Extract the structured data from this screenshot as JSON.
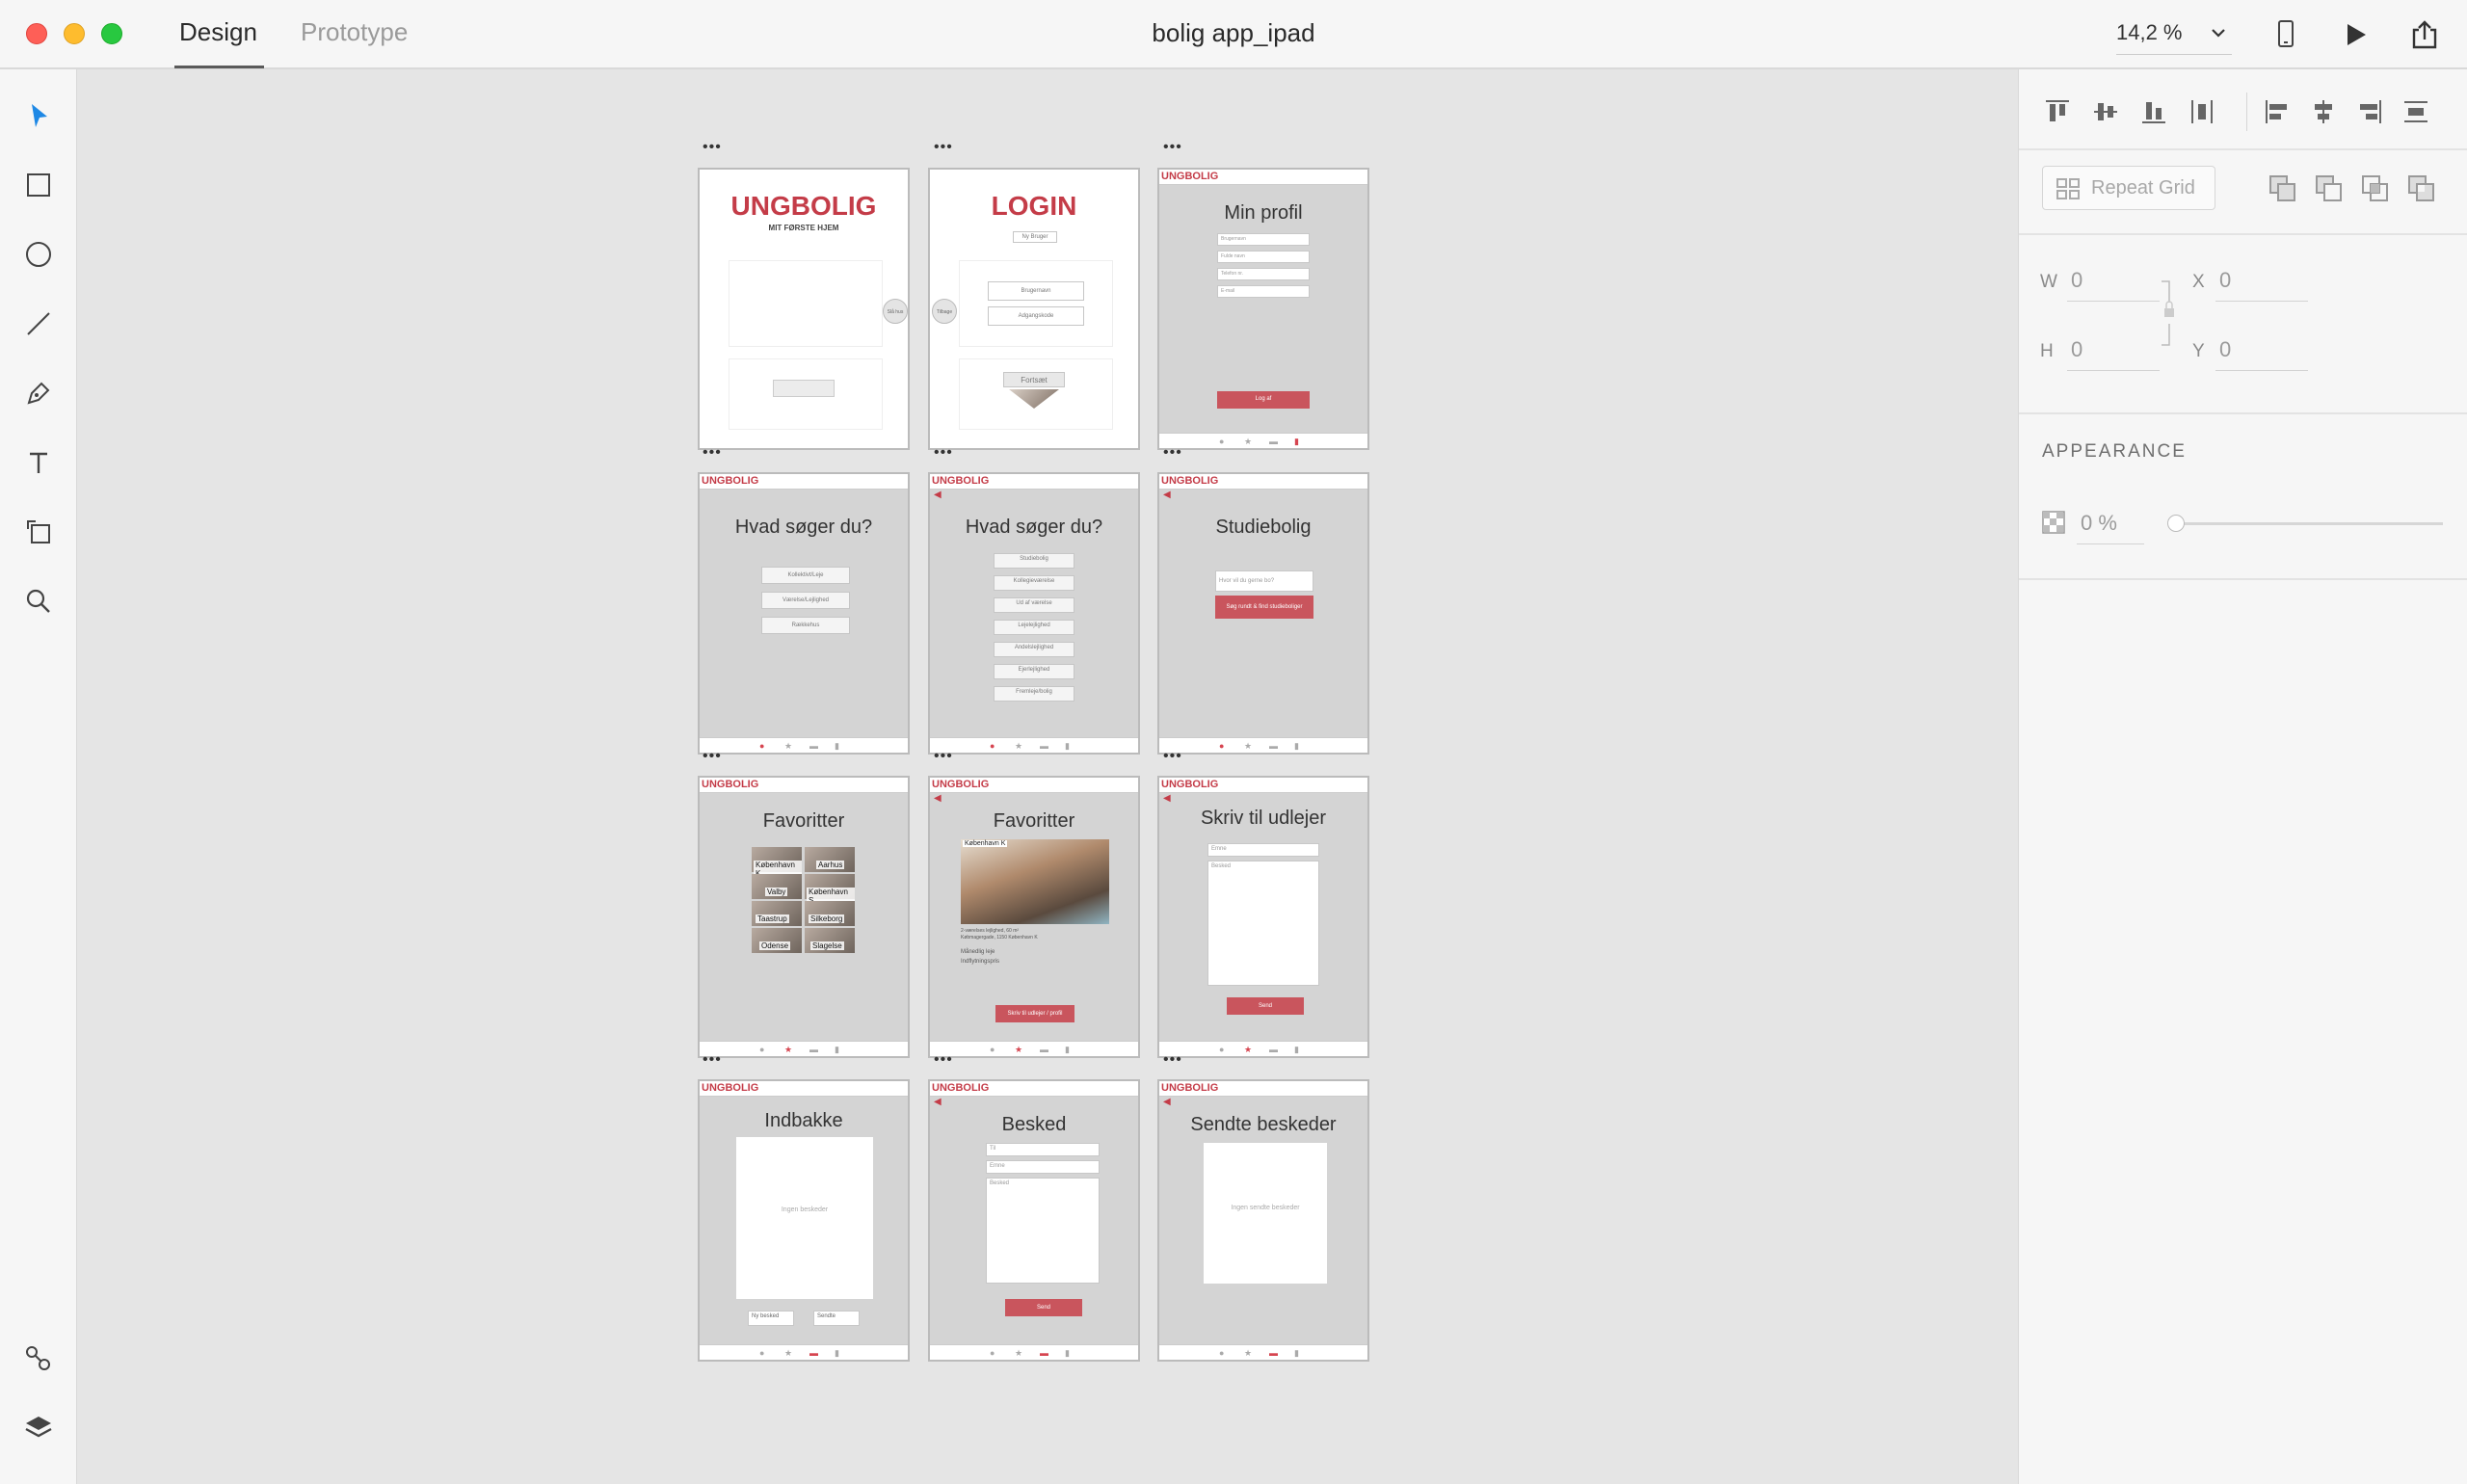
{
  "app": {
    "tabs": [
      "Design",
      "Prototype"
    ],
    "active_tab": "Design",
    "document_title": "bolig app_ipad",
    "zoom": "14,2 %"
  },
  "inspector": {
    "repeat_grid_label": "Repeat Grid",
    "w_label": "W",
    "w_value": "0",
    "x_label": "X",
    "x_value": "0",
    "h_label": "H",
    "h_value": "0",
    "y_label": "Y",
    "y_value": "0",
    "appearance_label": "APPEARANCE",
    "opacity_value": "0 %"
  },
  "brand": {
    "logo": "UNGBOLIG",
    "accent": "#c43c48"
  },
  "artboards": {
    "a1": {
      "logo": "UNGBOLIG",
      "tagline": "MIT FØRSTE HJEM",
      "side_btn": "Slå hus"
    },
    "a2": {
      "title": "LOGIN",
      "new_user": "Ny Bruger",
      "side_btn": "Tilbage",
      "username": "Brugernavn",
      "password": "Adgangskode",
      "continue": "Fortsæt"
    },
    "a3": {
      "title": "Min profil",
      "fields": [
        "Brugernavn",
        "Fulde navn",
        "Telefon nr.",
        "E-mail"
      ],
      "logout": "Log af"
    },
    "a4": {
      "title": "Hvad søger du?",
      "options": [
        "Kollektivt/Leje",
        "Værelse/Lejlighed",
        "Rækkehus"
      ]
    },
    "a5": {
      "title": "Hvad søger du?",
      "options": [
        "Studiebolig",
        "Kollegieværelse",
        "Ud af værelse",
        "Lejelejlighed",
        "Andelslejlighed",
        "Ejerlejlighed",
        "Fremleje/bolig"
      ]
    },
    "a6": {
      "title": "Studiebolig",
      "search_placeholder": "Hvor vil du gerne bo?",
      "button": "Søg rundt & find studieboliger"
    },
    "a7": {
      "title": "Favoritter",
      "cells": [
        "København K",
        "Aarhus",
        "Valby",
        "København S",
        "Taastrup",
        "Silkeborg",
        "Odense",
        "Slagelse"
      ]
    },
    "a8": {
      "title": "Favoritter",
      "photo_label": "København K",
      "desc_line1": "2-værelses lejlighed, 60 m²",
      "desc_line2": "Købmagergade, 1150 København K",
      "rent_label": "Månedlig leje",
      "deposit_label": "Indflytningspris",
      "contact_btn": "Skriv til udlejer / profil"
    },
    "a9": {
      "title": "Skriv til udlejer",
      "subject": "Emne",
      "message": "Besked",
      "send": "Send"
    },
    "a10": {
      "title": "Indbakke",
      "empty": "Ingen beskeder",
      "new_msg": "Ny besked",
      "sent": "Sendte"
    },
    "a11": {
      "title": "Besked",
      "to": "Til",
      "subject": "Emne",
      "message": "Besked",
      "send": "Send"
    },
    "a12": {
      "title": "Sendte beskeder",
      "empty": "Ingen sendte beskeder"
    }
  }
}
